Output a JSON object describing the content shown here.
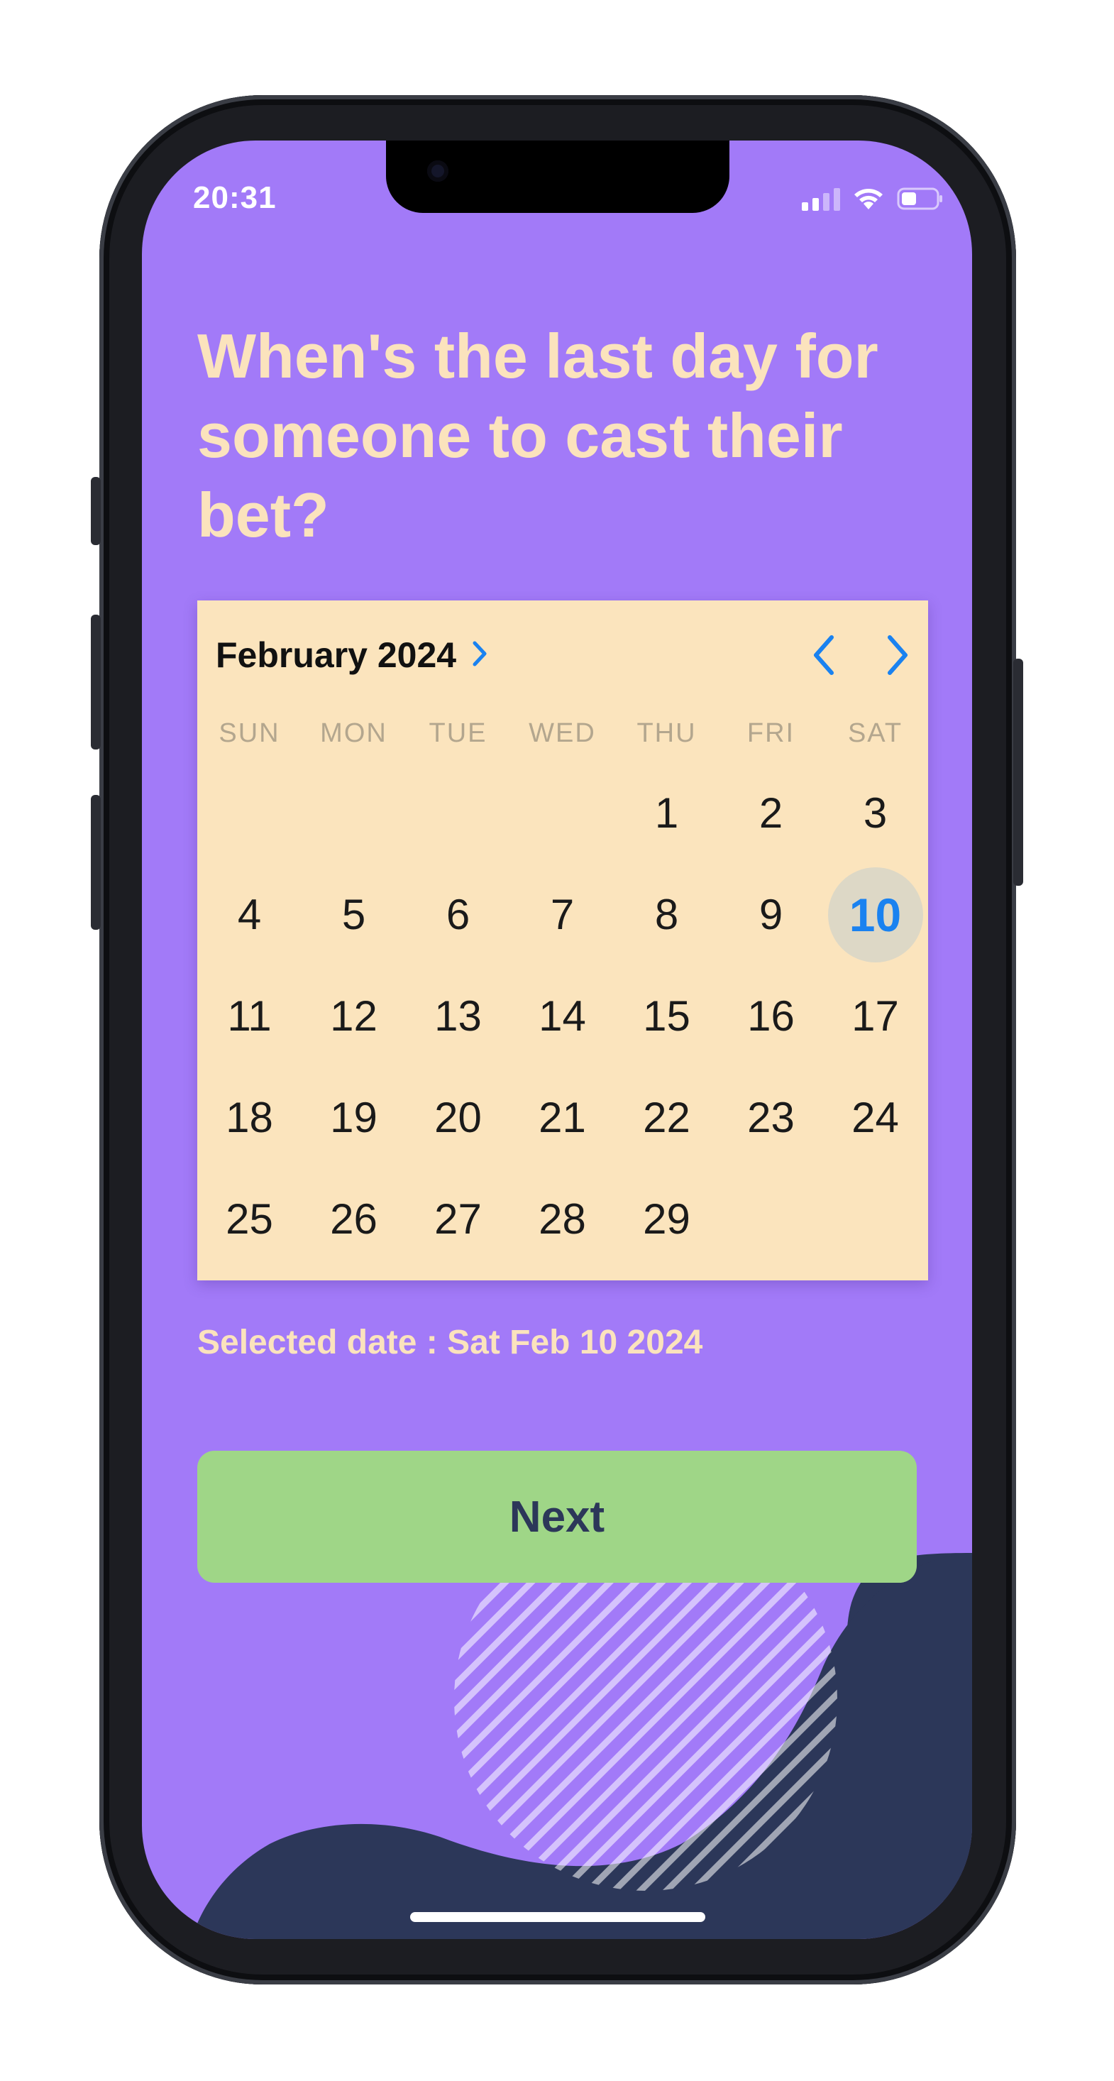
{
  "status_bar": {
    "time": "20:31"
  },
  "question": "When's the last day for someone to cast their bet?",
  "calendar": {
    "month_label": "February 2024",
    "weekdays": [
      "SUN",
      "MON",
      "TUE",
      "WED",
      "THU",
      "FRI",
      "SAT"
    ],
    "weeks": [
      [
        "",
        "",
        "",
        "",
        "1",
        "2",
        "3"
      ],
      [
        "4",
        "5",
        "6",
        "7",
        "8",
        "9",
        "10"
      ],
      [
        "11",
        "12",
        "13",
        "14",
        "15",
        "16",
        "17"
      ],
      [
        "18",
        "19",
        "20",
        "21",
        "22",
        "23",
        "24"
      ],
      [
        "25",
        "26",
        "27",
        "28",
        "29",
        "",
        ""
      ]
    ],
    "selected_day": "10"
  },
  "selected_date_text": "Selected date : Sat Feb 10 2024",
  "next_button": {
    "label": "Next"
  },
  "colors": {
    "background": "#a27af8",
    "title": "#fbe3bd",
    "calendar_bg": "#fbe4bd",
    "accent_blue": "#1a82f0",
    "button_bg": "#9fd687",
    "button_text": "#2c3759",
    "blob": "#2c3759"
  }
}
